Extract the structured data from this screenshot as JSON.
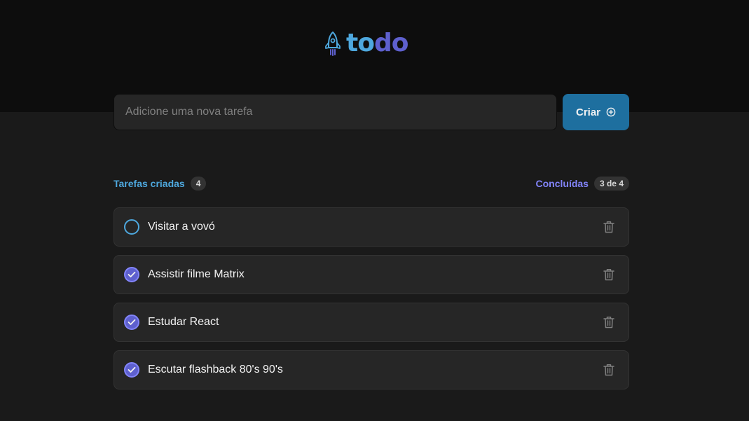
{
  "logo": {
    "part1": "to",
    "part2": "do",
    "icon": "rocket-icon"
  },
  "new_task": {
    "placeholder": "Adicione uma nova tarefa",
    "create_label": "Criar",
    "create_icon": "plus-circle-icon"
  },
  "counters": {
    "created_label": "Tarefas criadas",
    "created_count": "4",
    "done_label": "Concluídas",
    "done_count": "3 de 4"
  },
  "tasks": [
    {
      "text": "Visitar a vovó",
      "done": false
    },
    {
      "text": "Assistir filme Matrix",
      "done": true
    },
    {
      "text": "Estudar React",
      "done": true
    },
    {
      "text": "Escutar flashback 80's 90's",
      "done": true
    }
  ],
  "colors": {
    "blue": "#4ea8de",
    "blue_dark": "#1e6f9f",
    "purple": "#5e60ce",
    "purple_light": "#8284fa",
    "background": "#1a1a1a",
    "header": "#0d0d0d"
  }
}
